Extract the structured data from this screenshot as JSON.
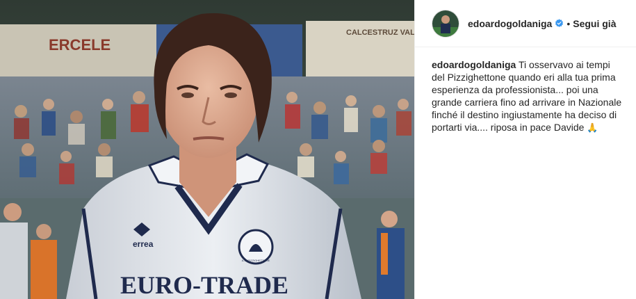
{
  "header": {
    "username": "edoardogoldaniga",
    "separator": "•",
    "follow_label": "Segui già"
  },
  "caption": {
    "username": "edoardogoldaniga",
    "text": "Ti osservavo ai tempi del Pizzighettone quando eri alla tua prima esperienza da professionista... poi una grande carriera fino ad arrivare in Nazionale finché il destino ingiustamente ha deciso di portarti via.... riposa in pace Davide",
    "emoji": "🙏"
  },
  "photo": {
    "sponsor_text": "EURO-TRADE",
    "brand_text": "errea",
    "crest_text": "A.S. PIZZIGHETTONE",
    "banner_left": "ERCELE",
    "banner_right": "CALCESTRUZ VALCAMONI"
  },
  "colors": {
    "verified": "#3897f0",
    "jersey": "#e6e9ee",
    "trim": "#1f2a4d"
  }
}
